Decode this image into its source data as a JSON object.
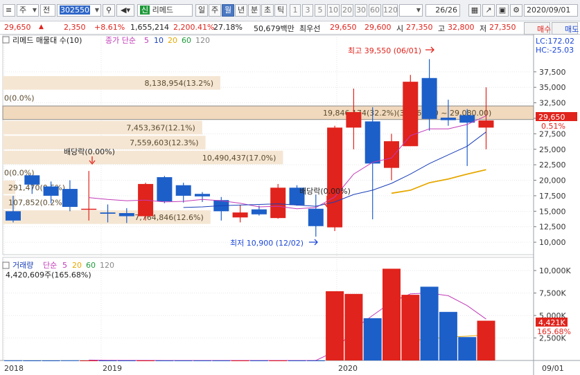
{
  "toolbar": {
    "market_label": "주",
    "market2_label": "전",
    "code": "302550",
    "stock_badge": "신",
    "stock_name": "리메드",
    "period_tabs": [
      "일",
      "주",
      "월",
      "년",
      "분",
      "초",
      "틱"
    ],
    "active_period": "월",
    "interval_buttons": [
      "1",
      "3",
      "5",
      "10",
      "20",
      "30",
      "60",
      "120"
    ],
    "page_counter": "26/26",
    "date": "2020/09/01"
  },
  "quote": {
    "price": "29,650",
    "change_arrow": "▲",
    "change": "2,350",
    "change_pct": "+8.61%",
    "volume": "1,655,214",
    "volume_ratio": "2,200.41%",
    "turnover": "27.18%",
    "amount": "50,679백만",
    "priority_label": "최우선",
    "ask_best": "29,650",
    "bid_best": "29,600",
    "open_label": "시",
    "open": "27,350",
    "high_label": "고",
    "high": "32,800",
    "low_label": "저",
    "low": "27,350",
    "buy_label": "매수",
    "sell_label": "매도"
  },
  "price_panel": {
    "legend_name": "리메드 매물대 수(10)",
    "legend_ma": "종가 단순",
    "legend_periods": [
      "5",
      "10",
      "20",
      "60",
      "120"
    ],
    "lc_label": "LC:172.02",
    "hc_label": "HC:-25.03",
    "current_price_tag": "29,650",
    "current_pct_tag": "0.51%",
    "ticks": [
      "37,500",
      "35,000",
      "32,500",
      "30,000",
      "27,500",
      "25,000",
      "22,500",
      "20,000",
      "17,500",
      "15,000",
      "12,500",
      "10,000"
    ],
    "high_annotation": "최고 39,550 (06/01)",
    "low_annotation": "최저 10,900 (12/02)",
    "dividend_1": "배당락(0.00%)",
    "dividend_2": "배당락(0.00%)",
    "volume_profile_labels": [
      "8,138,954(13.2%)",
      "0(0.0%)",
      "19,846,174(32.2%)(31,360.00 ~ 29,080.00)",
      "7,453,367(12.1%)",
      "7,559,603(12.3%)",
      "10,490,437(17.0%)",
      "0(0.0%)",
      "291,470(0.5%)",
      "107,852(0.2%)",
      "7,764,846(12.6%)"
    ]
  },
  "volume_panel": {
    "legend_name": "거래량",
    "legend_ma": "단순",
    "legend_periods": [
      "5",
      "20",
      "60",
      "120"
    ],
    "current_volume": "4,420,609주(165.68%)",
    "ticks": [
      "10,000K",
      "7,500K",
      "5,000K",
      "2,500K"
    ],
    "value_tag": "4,421K",
    "pct_tag": "165.68%"
  },
  "time_axis": {
    "labels": [
      "2018",
      "2019",
      "2020"
    ],
    "cursor_label": "09/01"
  },
  "colors": {
    "up": "#e0231c",
    "down": "#1d5fc9",
    "profile": "#f5e6d3",
    "profile_hot": "#f1d9bd",
    "ma5": "#c23ab8",
    "ma10": "#1a3fb8",
    "ma20": "#e6a800"
  },
  "chart_data": {
    "type": "candlestick",
    "price_candles": [
      {
        "label": "2018-06",
        "open": 15000,
        "high": 17500,
        "low": 13200,
        "close": 13500
      },
      {
        "label": "2018-07",
        "open": 20800,
        "high": 20800,
        "low": 17800,
        "close": 19300
      },
      {
        "label": "2018-08",
        "open": 19000,
        "high": 19800,
        "low": 16300,
        "close": 17500
      },
      {
        "label": "2018-09",
        "open": 18600,
        "high": 20000,
        "low": 15000,
        "close": 15700
      },
      {
        "label": "2018-10",
        "open": 15400,
        "high": 21500,
        "low": 13500,
        "close": 15400
      },
      {
        "label": "2018-11",
        "open": 14800,
        "high": 16100,
        "low": 13200,
        "close": 14600
      },
      {
        "label": "2018-12",
        "open": 14700,
        "high": 15500,
        "low": 13100,
        "close": 14200
      },
      {
        "label": "2019-01",
        "open": 14200,
        "high": 19600,
        "low": 13500,
        "close": 19400
      },
      {
        "label": "2019-02",
        "open": 20500,
        "high": 20700,
        "low": 16300,
        "close": 16600
      },
      {
        "label": "2019-03",
        "open": 19200,
        "high": 19600,
        "low": 16400,
        "close": 17500
      },
      {
        "label": "2019-04",
        "open": 17800,
        "high": 18100,
        "low": 16500,
        "close": 17400
      },
      {
        "label": "2019-05",
        "open": 16800,
        "high": 17300,
        "low": 13500,
        "close": 15000
      },
      {
        "label": "2019-06",
        "open": 14000,
        "high": 16000,
        "low": 13200,
        "close": 14800
      },
      {
        "label": "2019-07",
        "open": 15300,
        "high": 15900,
        "low": 14300,
        "close": 14500
      },
      {
        "label": "2019-08",
        "open": 13900,
        "high": 19400,
        "low": 13800,
        "close": 18800
      },
      {
        "label": "2019-09",
        "open": 18800,
        "high": 19200,
        "low": 15900,
        "close": 16000
      },
      {
        "label": "2019-10",
        "open": 15400,
        "high": 17700,
        "low": 10900,
        "close": 12600
      },
      {
        "label": "2019-11",
        "open": 12400,
        "high": 28800,
        "low": 11800,
        "close": 28500
      },
      {
        "label": "2019-12",
        "open": 28500,
        "high": 34800,
        "low": 25000,
        "close": 31000
      },
      {
        "label": "2020-01",
        "open": 29500,
        "high": 31800,
        "low": 13700,
        "close": 22700
      },
      {
        "label": "2020-02",
        "open": 22000,
        "high": 27500,
        "low": 20000,
        "close": 26300
      },
      {
        "label": "2020-03",
        "open": 25500,
        "high": 37000,
        "low": 25500,
        "close": 35900
      },
      {
        "label": "2020-04",
        "open": 36500,
        "high": 39550,
        "low": 28000,
        "close": 29900
      },
      {
        "label": "2020-05",
        "open": 30100,
        "high": 33000,
        "low": 28800,
        "close": 29700
      },
      {
        "label": "2020-06",
        "open": 30500,
        "high": 31500,
        "low": 22300,
        "close": 29300
      },
      {
        "label": "2020-07",
        "open": 28500,
        "high": 35000,
        "low": 25000,
        "close": 29650
      }
    ],
    "ma5": [
      null,
      null,
      null,
      null,
      17200,
      16900,
      16700,
      16800,
      16500,
      16600,
      16900,
      16700,
      16300,
      15700,
      15800,
      15400,
      15600,
      17300,
      21000,
      22900,
      23600,
      27200,
      28300,
      28300,
      29000,
      30400
    ],
    "ma10": [
      null,
      null,
      null,
      null,
      null,
      null,
      null,
      null,
      null,
      15600,
      15700,
      15900,
      16000,
      16100,
      16200,
      16000,
      15800,
      16500,
      17700,
      18400,
      19500,
      21000,
      22700,
      24100,
      25500,
      27800
    ],
    "ma20": [
      null,
      null,
      null,
      null,
      null,
      null,
      null,
      null,
      null,
      null,
      null,
      null,
      null,
      null,
      null,
      null,
      null,
      null,
      null,
      null,
      17900,
      18400,
      19600,
      20200,
      21000,
      21700
    ],
    "volumes_k": [
      10,
      0,
      0,
      12,
      0,
      0,
      0,
      0,
      0,
      0,
      0,
      0,
      0,
      0,
      0,
      0,
      0,
      7700,
      7400,
      4700,
      10200,
      7300,
      8200,
      5400,
      2600,
      4421
    ],
    "vol_ma5_k": [
      null,
      null,
      null,
      null,
      50,
      20,
      10,
      5,
      2,
      0,
      0,
      0,
      0,
      0,
      0,
      0,
      0,
      1000,
      3500,
      5000,
      6500,
      7400,
      7500,
      7200,
      6100,
      4600
    ],
    "vol_ma20_k": [
      null,
      null,
      null,
      null,
      null,
      null,
      null,
      null,
      null,
      null,
      null,
      null,
      null,
      null,
      null,
      null,
      null,
      null,
      null,
      null,
      null,
      2200,
      2400,
      2600,
      2700,
      2850
    ],
    "price_axis_range": [
      8000,
      41500
    ],
    "volume_axis_range": [
      0,
      11000
    ],
    "volume_profile_pct": [
      13.2,
      0.0,
      32.2,
      12.1,
      12.3,
      17.0,
      0.0,
      0.5,
      0.2,
      12.6
    ]
  }
}
